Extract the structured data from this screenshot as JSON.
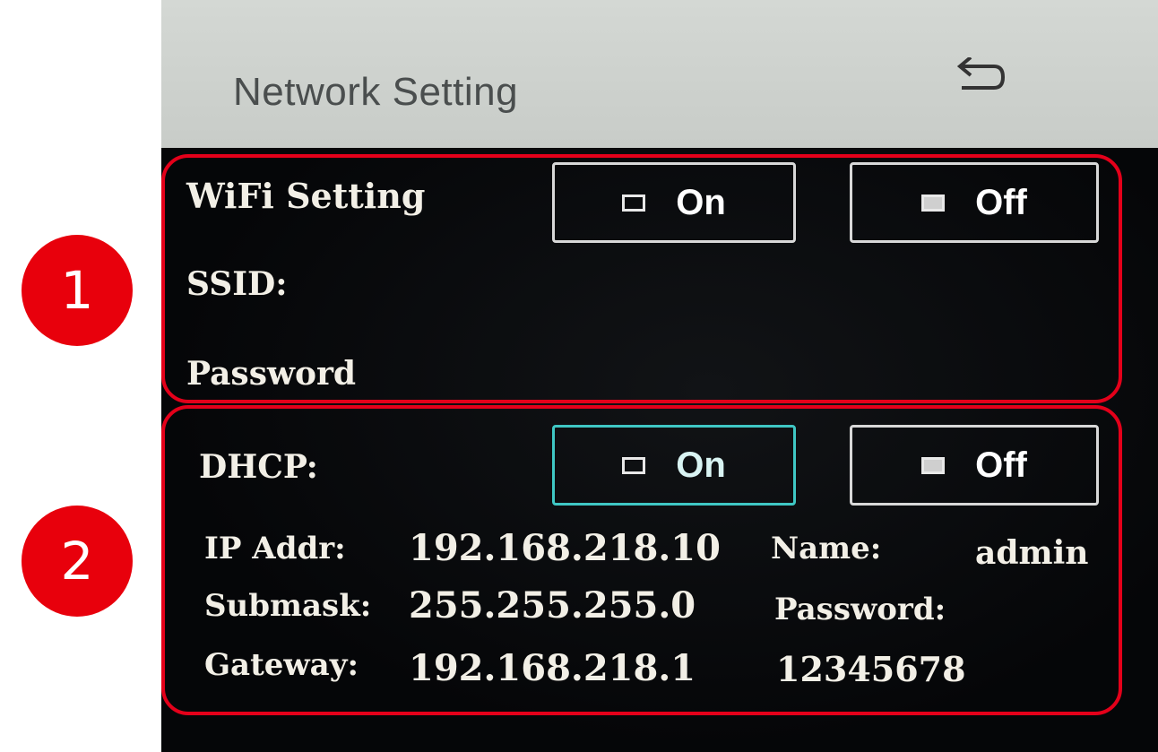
{
  "header": {
    "title": "Network Setting",
    "back_icon": "back-arrow-icon"
  },
  "wifi": {
    "label": "WiFi Setting",
    "on_label": "On",
    "off_label": "Off",
    "ssid_label": "SSID:",
    "password_label": "Password"
  },
  "dhcp": {
    "label": "DHCP:",
    "on_label": "On",
    "off_label": "Off",
    "selected": "On",
    "ip_label": "IP Addr:",
    "ip_value": "192.168.218.10",
    "submask_label": "Submask:",
    "submask_value": "255.255.255.0",
    "gateway_label": "Gateway:",
    "gateway_value": "192.168.218.1",
    "name_label": "Name:",
    "name_value": "admin",
    "password_label": "Password:",
    "password_value": "12345678"
  },
  "annotations": {
    "badge_1": "1",
    "badge_2": "2"
  },
  "colors": {
    "highlight": "#e4001a",
    "selected_border": "#3fc7c4",
    "screen_bg": "#050608",
    "header_bg": "#cfd3cf"
  }
}
